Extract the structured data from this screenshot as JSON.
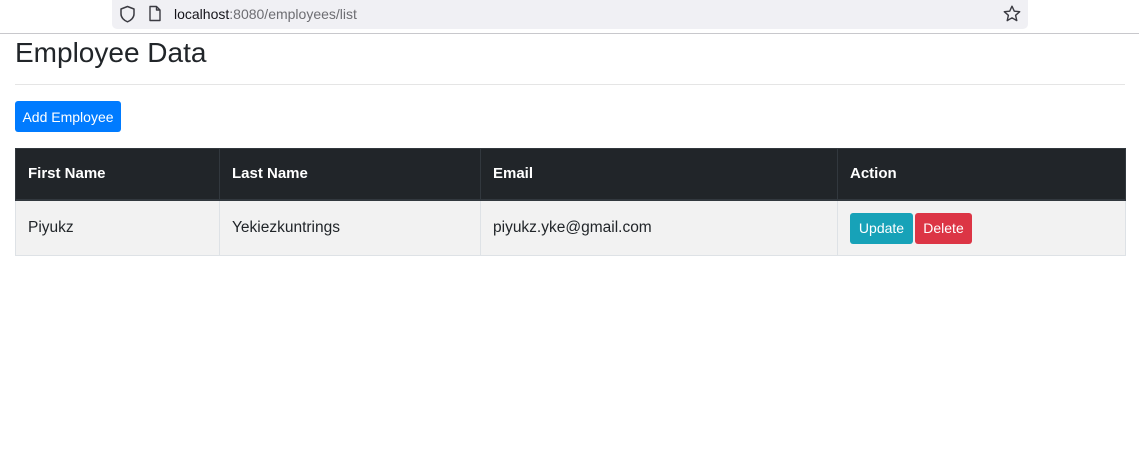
{
  "browser": {
    "url_host": "localhost",
    "url_path": ":8080/employees/list"
  },
  "page": {
    "title": "Employee Data",
    "add_button_label": "Add Employee"
  },
  "table": {
    "headers": [
      "First Name",
      "Last Name",
      "Email",
      "Action"
    ],
    "rows": [
      {
        "first_name": "Piyukz",
        "last_name": "Yekiezkuntrings",
        "email": "piyukz.yke@gmail.com",
        "update_label": "Update",
        "delete_label": "Delete"
      }
    ]
  },
  "colors": {
    "primary": "#007bff",
    "info": "#17a2b8",
    "danger": "#dc3545",
    "table_header": "#212529"
  }
}
